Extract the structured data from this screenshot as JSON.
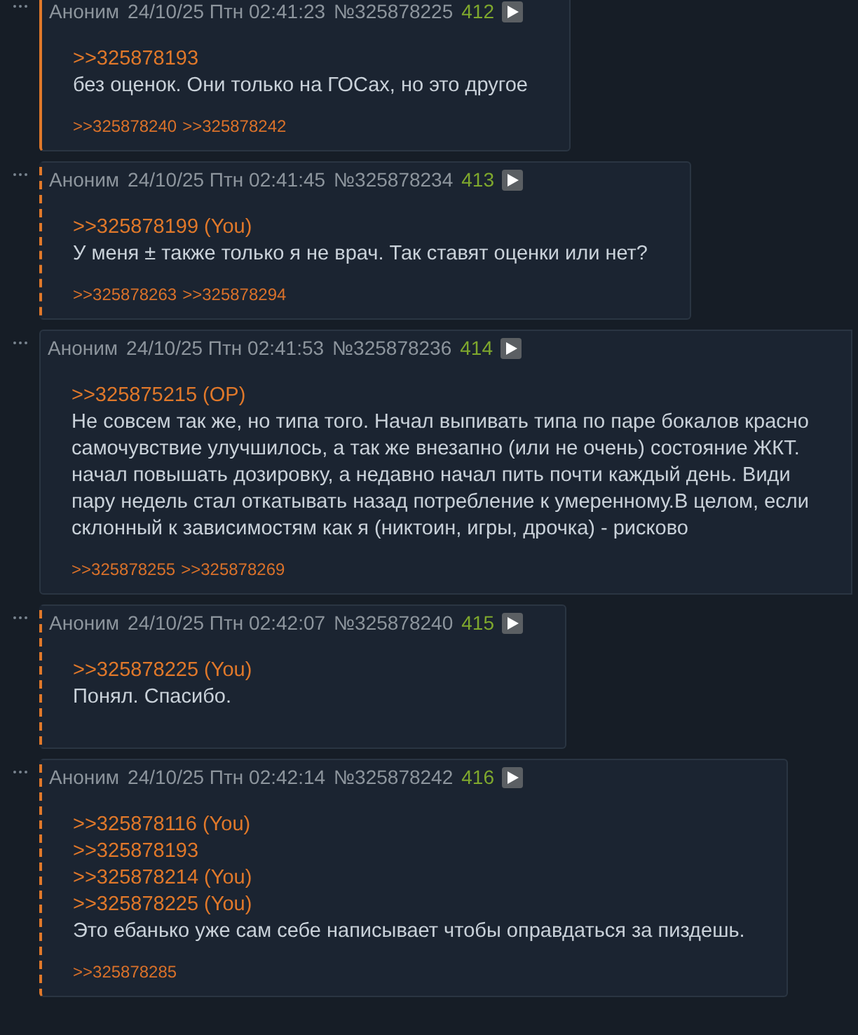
{
  "posts": [
    {
      "kind": "solid",
      "author": "Аноним",
      "date": "24/10/25 Птн 02:41:23",
      "number": "№325878225",
      "ordinal": "412",
      "quotes": [
        ">>325878193"
      ],
      "lines": [
        "без оценок. Они только на ГОСах, но это другое"
      ],
      "replies": [
        ">>325878240",
        ">>325878242"
      ]
    },
    {
      "kind": "dashed",
      "author": "Аноним",
      "date": "24/10/25 Птн 02:41:45",
      "number": "№325878234",
      "ordinal": "413",
      "quotes": [
        ">>325878199 (You)"
      ],
      "lines": [
        "У меня ± также только я не врач. Так ставят оценки или нет?"
      ],
      "replies": [
        ">>325878263",
        ">>325878294"
      ]
    },
    {
      "kind": "none",
      "author": "Аноним",
      "date": "24/10/25 Птн 02:41:53",
      "number": "№325878236",
      "ordinal": "414",
      "quotes": [
        ">>325875215 (OP)"
      ],
      "lines": [
        "Не совсем так же, но типа того. Начал выпивать типа по паре бокалов красно",
        "самочувствие улучшилось, а так же внезапно (или не очень) состояние ЖКТ.",
        "начал повышать дозировку, а недавно начал пить почти каждый день. Види",
        "пару недель стал откатывать назад потребление к умеренному.В целом, если",
        "склонный к зависимостям как я (никтоин, игры, дрочка) - рисково"
      ],
      "replies": [
        ">>325878255",
        ">>325878269"
      ]
    },
    {
      "kind": "dashed",
      "author": "Аноним",
      "date": "24/10/25 Птн 02:42:07",
      "number": "№325878240",
      "ordinal": "415",
      "quotes": [
        ">>325878225 (You)"
      ],
      "lines": [
        "Понял. Спасибо."
      ]
    },
    {
      "kind": "dashed",
      "author": "Аноним",
      "date": "24/10/25 Птн 02:42:14",
      "number": "№325878242",
      "ordinal": "416",
      "quotes": [
        ">>325878116 (You)",
        ">>325878193",
        ">>325878214 (You)",
        ">>325878225 (You)"
      ],
      "lines": [
        "Это ебанько уже сам себе написывает чтобы оправдаться за пиздешь."
      ],
      "replies": [
        ">>325878285"
      ]
    }
  ]
}
